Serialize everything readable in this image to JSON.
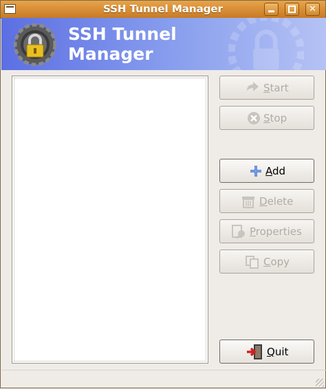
{
  "window": {
    "title": "SSH Tunnel Manager"
  },
  "banner": {
    "title_line1": "SSH Tunnel",
    "title_line2": "Manager"
  },
  "buttons": {
    "start": {
      "mnemonic": "S",
      "rest": "tart",
      "enabled": false,
      "icon": "start-arrow-icon"
    },
    "stop": {
      "mnemonic": "S",
      "rest": "top",
      "enabled": false,
      "icon": "stop-icon"
    },
    "add": {
      "mnemonic": "A",
      "rest": "dd",
      "enabled": true,
      "icon": "plus-icon"
    },
    "delete": {
      "mnemonic": "D",
      "rest": "elete",
      "enabled": false,
      "icon": "delete-icon"
    },
    "properties": {
      "mnemonic": "P",
      "rest": "roperties",
      "enabled": false,
      "icon": "properties-icon"
    },
    "copy": {
      "mnemonic": "C",
      "rest": "opy",
      "enabled": false,
      "icon": "copy-icon"
    },
    "quit": {
      "mnemonic": "Q",
      "rest": "uit",
      "enabled": true,
      "icon": "quit-door-icon"
    }
  },
  "colors": {
    "titlebar": "#d8903a",
    "banner": "#6a7fe8",
    "plus": "#3a6ad0",
    "quit_arrow": "#d02020"
  }
}
